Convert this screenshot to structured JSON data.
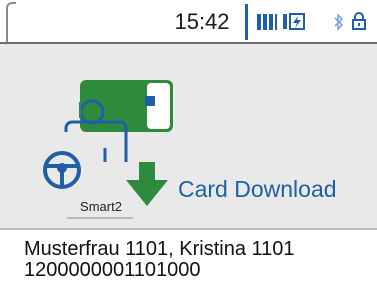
{
  "status_bar": {
    "time": "15:42",
    "icons": [
      "signal-bars-icon",
      "battery-charging-icon",
      "bluetooth-icon",
      "lock-icon"
    ]
  },
  "main": {
    "action_label": "Card Download",
    "device_label": "Smart2",
    "illustration": [
      "card-icon",
      "steering-wheel-icon",
      "download-arrow-icon"
    ]
  },
  "footer": {
    "name": "Musterfrau 1101, Kristina 1101",
    "card_number": "1200000001101000"
  },
  "colors": {
    "accent_blue": "#1f5fa5",
    "card_green": "#2e8b3e",
    "background": "#e9e9e9"
  }
}
